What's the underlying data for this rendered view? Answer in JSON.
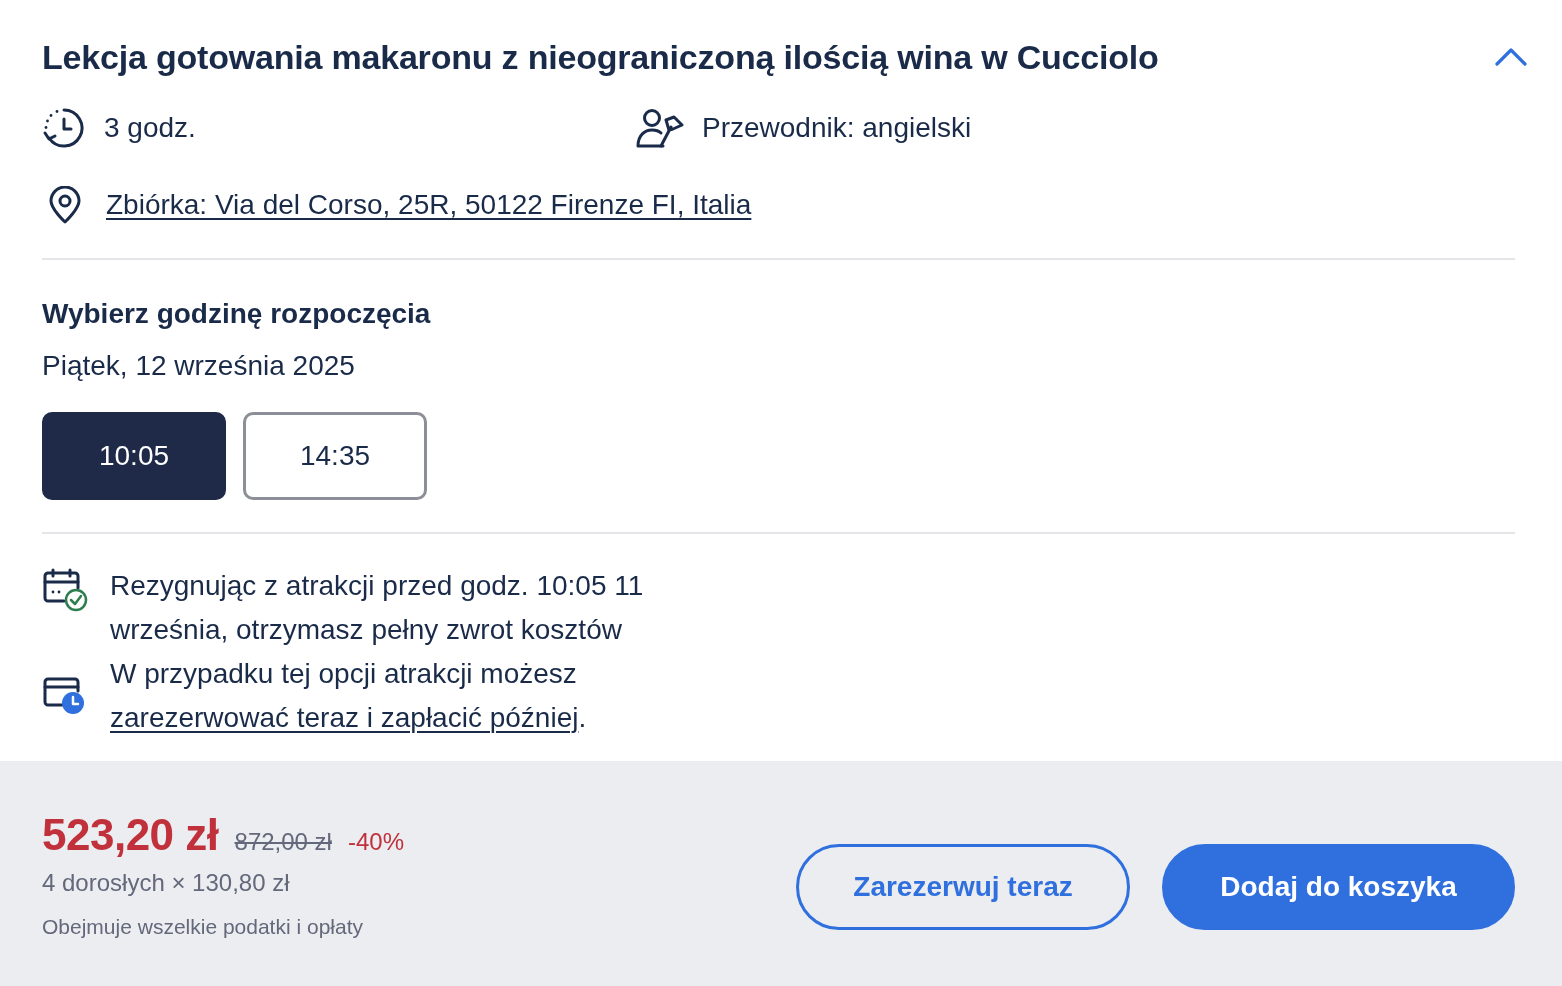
{
  "activity": {
    "title": "Lekcja gotowania makaronu z nieograniczoną ilością wina w Cucciolo",
    "expanded": true,
    "details": [
      {
        "kind": "duration",
        "text": "3 godz."
      },
      {
        "kind": "guide",
        "text": "Przewodnik: angielski"
      }
    ],
    "meeting_point": "Zbiórka: Via del Corso, 25R, 50122 Firenze FI, Italia"
  },
  "start_time": {
    "heading": "Wybierz godzinę rozpoczęcia",
    "date": "Piątek, 12 września 2025",
    "times": [
      {
        "label": "10:05",
        "selected": true
      },
      {
        "label": "14:35",
        "selected": false
      }
    ]
  },
  "policies": [
    {
      "kind": "free_cancellation",
      "text": "Rezygnując z atrakcji przed godz. 10:05 11 września, otrzymasz pełny zwrot kosztów"
    },
    {
      "kind": "pay_later",
      "text": "W przypadku tej opcji atrakcji możesz ",
      "link": "zarezerwować teraz i zapłacić później",
      "text_after": "."
    }
  ],
  "price": {
    "current": "523,20 zł",
    "original": "872,00 zł",
    "discount": "-40%",
    "breakdown": "4 dorosłych × 130,80 zł",
    "note": "Obejmuje wszelkie podatki i opłaty"
  },
  "actions": [
    {
      "kind": "secondary",
      "label": "Zarezerwuj teraz"
    },
    {
      "kind": "primary",
      "label": "Dodaj do koszyka"
    }
  ]
}
